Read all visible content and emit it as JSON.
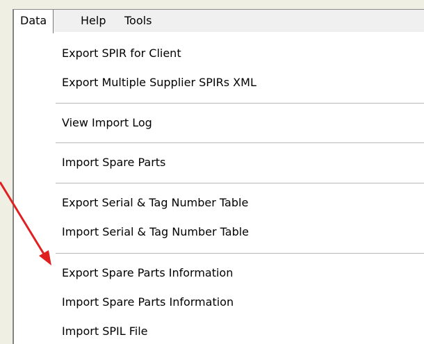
{
  "menubar": {
    "items": [
      {
        "label": "Data"
      },
      {
        "label": "Help"
      },
      {
        "label": "Tools"
      }
    ]
  },
  "dropdown": {
    "items": [
      {
        "label": "Export SPIR for Client"
      },
      {
        "label": "Export Multiple Supplier SPIRs XML"
      },
      {
        "label": "View Import Log"
      },
      {
        "label": "Import Spare Parts"
      },
      {
        "label": "Export Serial & Tag Number Table"
      },
      {
        "label": "Import Serial & Tag Number Table"
      },
      {
        "label": "Export Spare Parts Information"
      },
      {
        "label": "Import Spare Parts Information"
      },
      {
        "label": "Import SPIL File"
      }
    ]
  },
  "annotation": {
    "arrow_color": "#e02020",
    "target_item": "Export Spare Parts Information"
  }
}
